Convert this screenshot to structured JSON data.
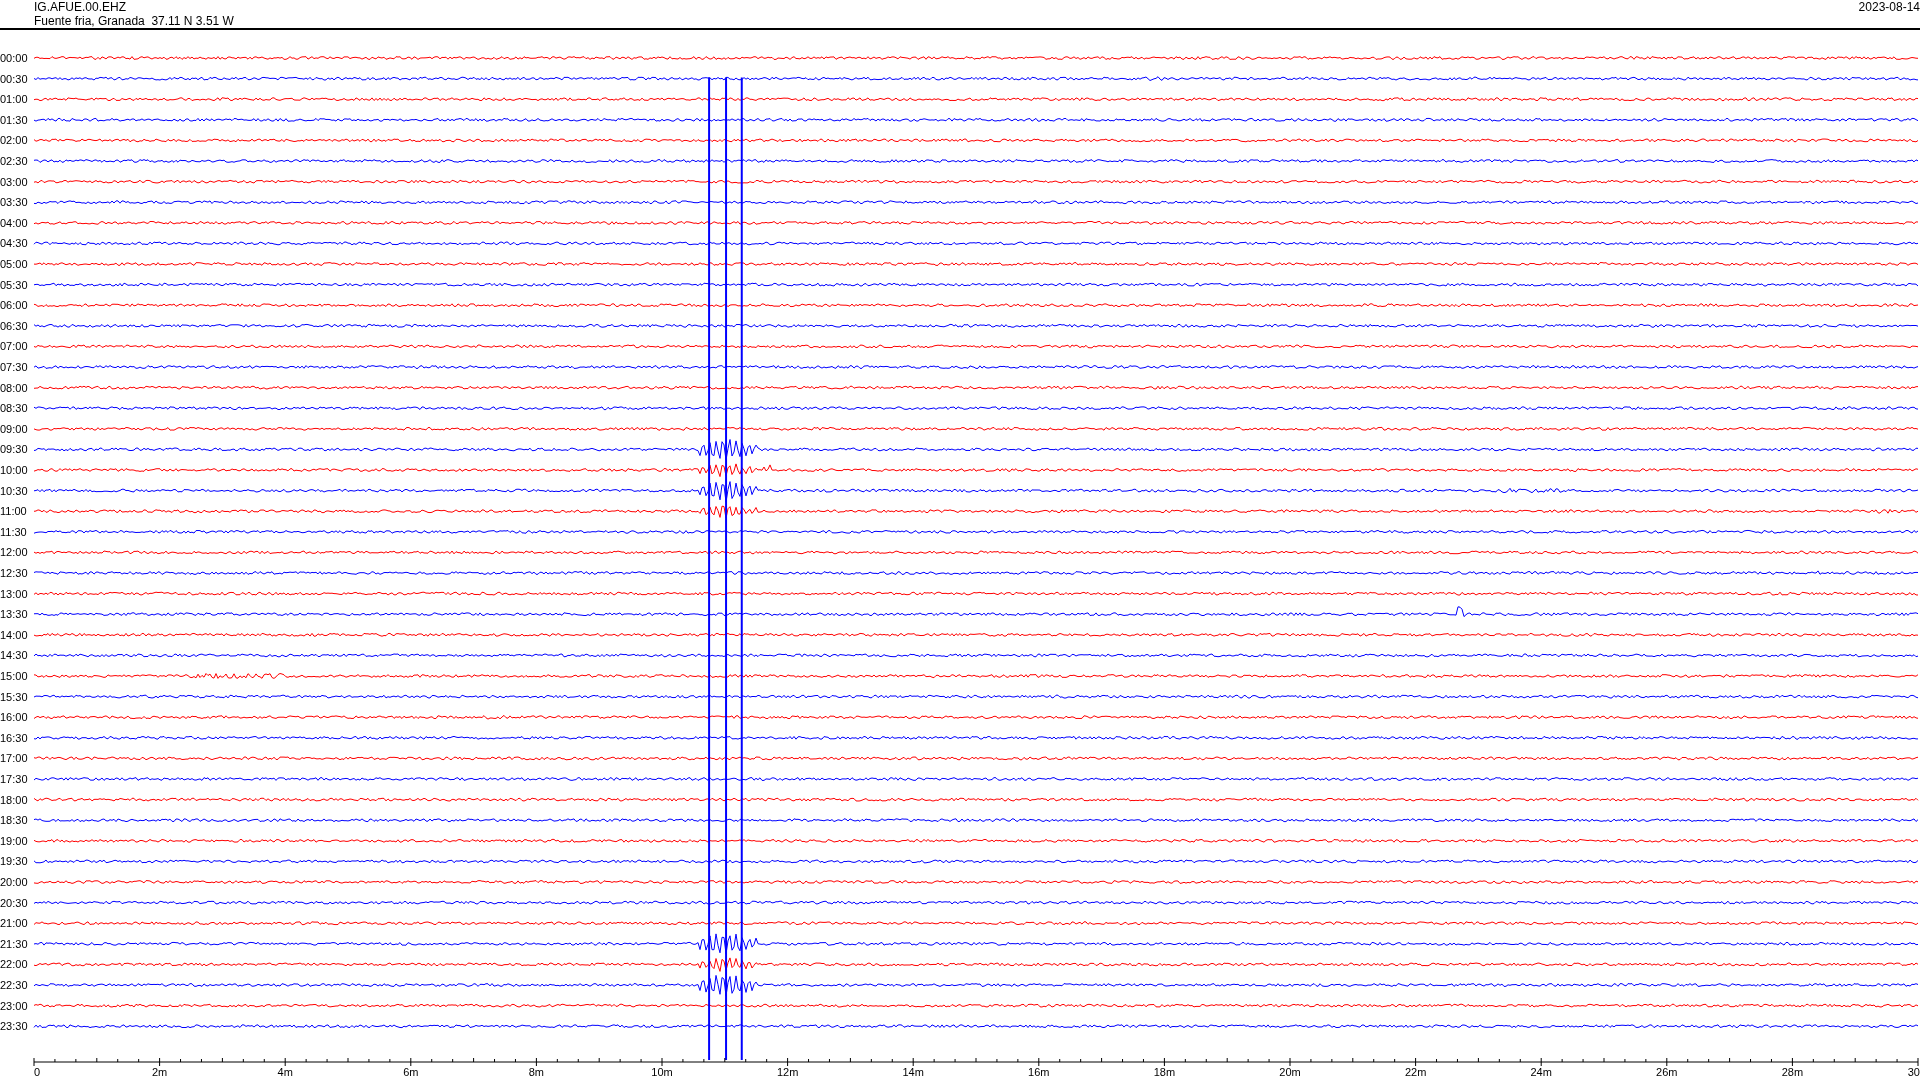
{
  "header": {
    "station": "IG.AFUE.00.EHZ",
    "location": "Fuente fria, Granada  37.11 N 3.51 W",
    "date": "2023-08-14"
  },
  "traces": [
    {
      "time": "00:00",
      "color": "#ff0000"
    },
    {
      "time": "00:30",
      "color": "#0000ff"
    },
    {
      "time": "01:00",
      "color": "#ff0000"
    },
    {
      "time": "01:30",
      "color": "#0000ff"
    },
    {
      "time": "02:00",
      "color": "#ff0000"
    },
    {
      "time": "02:30",
      "color": "#0000ff"
    },
    {
      "time": "03:00",
      "color": "#ff0000"
    },
    {
      "time": "03:30",
      "color": "#0000ff"
    },
    {
      "time": "04:00",
      "color": "#ff0000"
    },
    {
      "time": "04:30",
      "color": "#0000ff"
    },
    {
      "time": "05:00",
      "color": "#ff0000"
    },
    {
      "time": "05:30",
      "color": "#0000ff"
    },
    {
      "time": "06:00",
      "color": "#ff0000"
    },
    {
      "time": "06:30",
      "color": "#0000ff"
    },
    {
      "time": "07:00",
      "color": "#ff0000"
    },
    {
      "time": "07:30",
      "color": "#0000ff"
    },
    {
      "time": "08:00",
      "color": "#ff0000"
    },
    {
      "time": "08:30",
      "color": "#0000ff"
    },
    {
      "time": "09:00",
      "color": "#ff0000"
    },
    {
      "time": "09:30",
      "color": "#0000ff"
    },
    {
      "time": "10:00",
      "color": "#ff0000"
    },
    {
      "time": "10:30",
      "color": "#0000ff"
    },
    {
      "time": "11:00",
      "color": "#ff0000"
    },
    {
      "time": "11:30",
      "color": "#0000ff"
    },
    {
      "time": "12:00",
      "color": "#ff0000"
    },
    {
      "time": "12:30",
      "color": "#0000ff"
    },
    {
      "time": "13:00",
      "color": "#ff0000"
    },
    {
      "time": "13:30",
      "color": "#0000ff"
    },
    {
      "time": "14:00",
      "color": "#ff0000"
    },
    {
      "time": "14:30",
      "color": "#0000ff"
    },
    {
      "time": "15:00",
      "color": "#ff0000"
    },
    {
      "time": "15:30",
      "color": "#0000ff"
    },
    {
      "time": "16:00",
      "color": "#ff0000"
    },
    {
      "time": "16:30",
      "color": "#0000ff"
    },
    {
      "time": "17:00",
      "color": "#ff0000"
    },
    {
      "time": "17:30",
      "color": "#0000ff"
    },
    {
      "time": "18:00",
      "color": "#ff0000"
    },
    {
      "time": "18:30",
      "color": "#0000ff"
    },
    {
      "time": "19:00",
      "color": "#ff0000"
    },
    {
      "time": "19:30",
      "color": "#0000ff"
    },
    {
      "time": "20:00",
      "color": "#ff0000"
    },
    {
      "time": "20:30",
      "color": "#0000ff"
    },
    {
      "time": "21:00",
      "color": "#ff0000"
    },
    {
      "time": "21:30",
      "color": "#0000ff"
    },
    {
      "time": "22:00",
      "color": "#ff0000"
    },
    {
      "time": "22:30",
      "color": "#0000ff"
    },
    {
      "time": "23:00",
      "color": "#ff0000"
    },
    {
      "time": "23:30",
      "color": "#0000ff"
    }
  ],
  "x_axis": {
    "ticks": [
      "0",
      "2m",
      "4m",
      "6m",
      "8m",
      "10m",
      "12m",
      "14m",
      "16m",
      "18m",
      "20m",
      "22m",
      "24m",
      "26m",
      "28m",
      "30"
    ]
  }
}
